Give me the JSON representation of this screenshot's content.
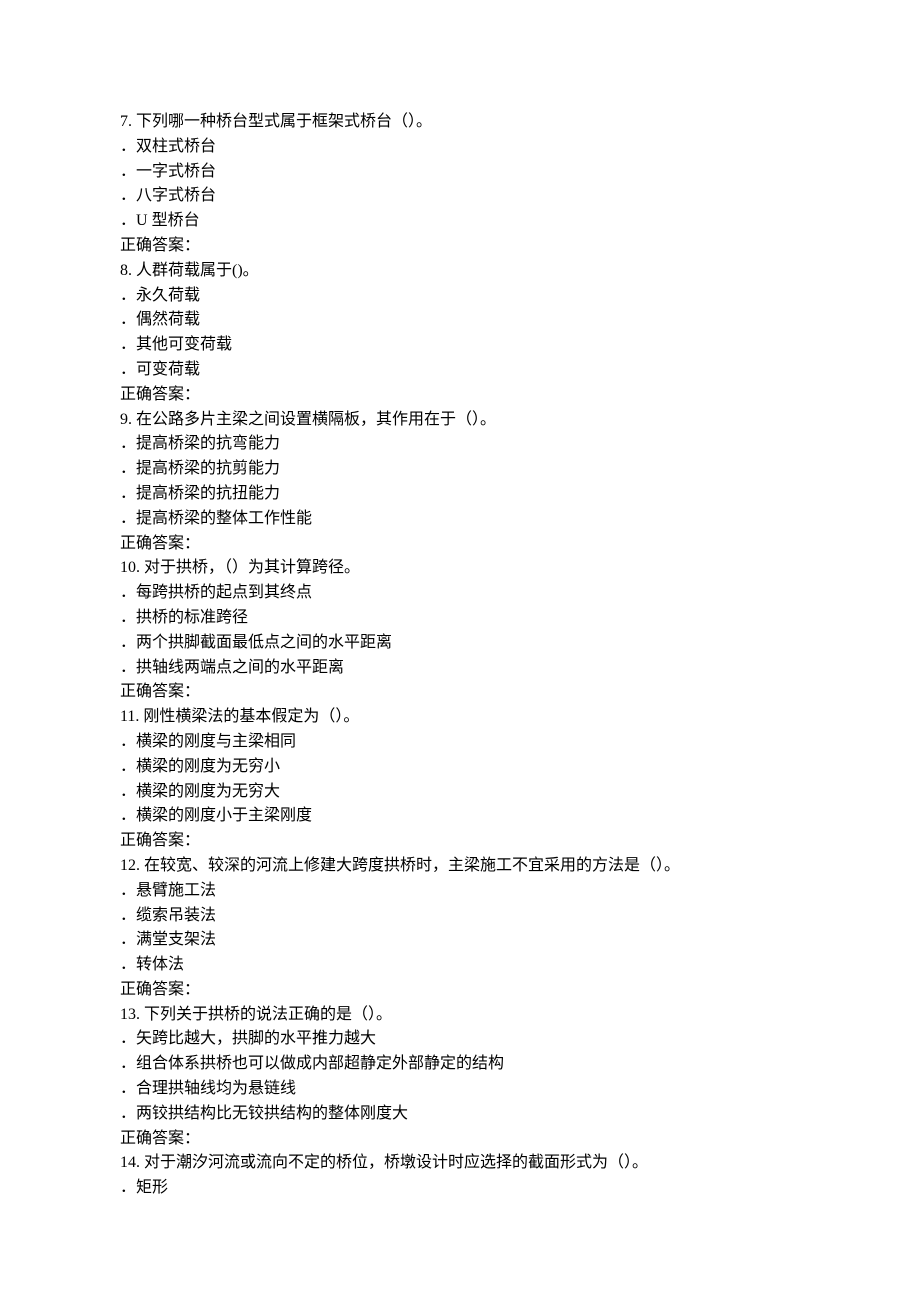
{
  "questions": [
    {
      "num": "7. ",
      "text": "下列哪一种桥台型式属于框架式桥台（）。",
      "opts": [
        "双柱式桥台",
        "一字式桥台",
        "八字式桥台",
        "U 型桥台"
      ],
      "ans_label": "正确答案："
    },
    {
      "num": "8. ",
      "text": "人群荷载属于()。",
      "opts": [
        "永久荷载",
        "偶然荷载",
        "其他可变荷载",
        "可变荷载"
      ],
      "ans_label": "正确答案："
    },
    {
      "num": "9. ",
      "text": "在公路多片主梁之间设置横隔板，其作用在于（）。",
      "opts": [
        "提高桥梁的抗弯能力",
        "提高桥梁的抗剪能力",
        "提高桥梁的抗扭能力",
        "提高桥梁的整体工作性能"
      ],
      "ans_label": "正确答案："
    },
    {
      "num": "10. ",
      "text": "对于拱桥，（）为其计算跨径。",
      "opts": [
        "每跨拱桥的起点到其终点",
        "拱桥的标准跨径",
        "两个拱脚截面最低点之间的水平距离",
        "拱轴线两端点之间的水平距离"
      ],
      "ans_label": "正确答案："
    },
    {
      "num": "11. ",
      "text": "刚性横梁法的基本假定为（）。",
      "opts": [
        "横梁的刚度与主梁相同",
        "横梁的刚度为无穷小",
        "横梁的刚度为无穷大",
        "横梁的刚度小于主梁刚度"
      ],
      "ans_label": "正确答案："
    },
    {
      "num": "12. ",
      "text": "在较宽、较深的河流上修建大跨度拱桥时，主梁施工不宜采用的方法是（）。",
      "opts": [
        "悬臂施工法",
        "缆索吊装法",
        "满堂支架法",
        "转体法"
      ],
      "ans_label": "正确答案："
    },
    {
      "num": "13. ",
      "text": "下列关于拱桥的说法正确的是（）。",
      "opts": [
        "矢跨比越大，拱脚的水平推力越大",
        "组合体系拱桥也可以做成内部超静定外部静定的结构",
        "合理拱轴线均为悬链线",
        "两铰拱结构比无铰拱结构的整体刚度大"
      ],
      "ans_label": "正确答案："
    },
    {
      "num": "14. ",
      "text": "对于潮汐河流或流向不定的桥位，桥墩设计时应选择的截面形式为（）。",
      "opts": [
        "矩形"
      ],
      "ans_label": null
    }
  ],
  "dot": "．"
}
